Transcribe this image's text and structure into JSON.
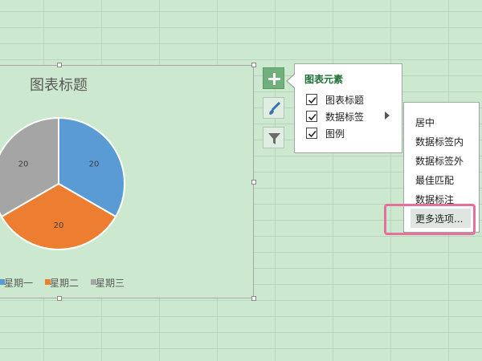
{
  "chart": {
    "title": "图表标题"
  },
  "chart_data": {
    "type": "pie",
    "title": "图表标题",
    "categories": [
      "星期一",
      "星期二",
      "星期三"
    ],
    "values": [
      20,
      20,
      20
    ],
    "data_labels": [
      "20",
      "20",
      "20"
    ],
    "colors": [
      "#5b9bd5",
      "#ed7d31",
      "#a5a5a5"
    ],
    "legend_position": "bottom"
  },
  "side_buttons": {
    "elements_icon": "plus-icon",
    "styles_icon": "brush-icon",
    "filter_icon": "filter-icon"
  },
  "chart_elements_panel": {
    "heading": "图表元素",
    "options": [
      {
        "label": "图表标题",
        "checked": true
      },
      {
        "label": "数据标签",
        "checked": true
      },
      {
        "label": "图例",
        "checked": true
      }
    ]
  },
  "data_label_submenu": {
    "items": [
      "居中",
      "数据标签内",
      "数据标签外",
      "最佳匹配",
      "数据标注",
      "更多选项..."
    ]
  },
  "colors": {
    "sheet_bg": "#cce8cf",
    "accent_green": "#71b07c",
    "highlight": "#e5709b"
  }
}
